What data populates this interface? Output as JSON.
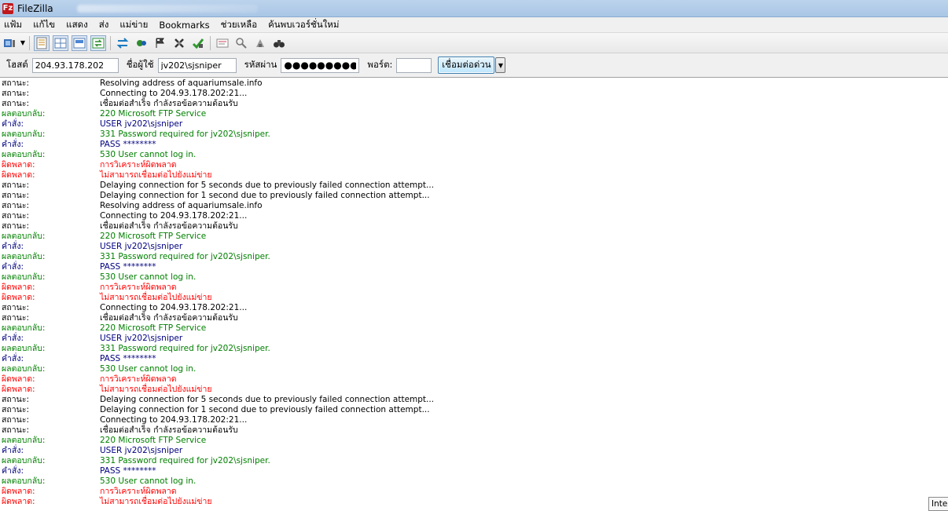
{
  "window": {
    "title": "FileZilla",
    "app_icon": "Fz"
  },
  "menu": [
    {
      "label": "แฟ้ม"
    },
    {
      "label": "แก้ไข"
    },
    {
      "label": "แสดง"
    },
    {
      "label": "ส่ง"
    },
    {
      "label": "แม่ข่าย"
    },
    {
      "label": "Bookmarks"
    },
    {
      "label": "ช่วยเหลือ"
    },
    {
      "label": "ค้นพบเวอร์ชั่นใหม่"
    }
  ],
  "toolbar": {
    "icons": [
      "site-manager-icon",
      "dropdown-arrow-icon",
      "message-log-toggle-icon",
      "local-tree-toggle-icon",
      "remote-tree-toggle-icon",
      "transfer-queue-toggle-icon",
      "refresh-icon",
      "process-queue-icon",
      "cancel-operation-icon",
      "disconnect-icon",
      "reconnect-icon",
      "filter-icon",
      "directory-comparison-icon",
      "synchronized-browsing-icon",
      "search-binoculars-icon"
    ]
  },
  "quickconnect": {
    "host_label": "โฮสต์",
    "host_value": "204.93.178.202",
    "user_label": "ชื่อผู้ใช้",
    "user_value": "jv202\\sjsniper",
    "pass_label": "รหัสผ่าน",
    "pass_value": "●●●●●●●●●",
    "port_label": "พอร์ต:",
    "port_value": "",
    "connect_label": "เชื่อมต่อด่วน",
    "dropdown_glyph": "▼"
  },
  "colors": {
    "status": "#000000",
    "response": "#008000",
    "command": "#000080",
    "error": "#ff0000"
  },
  "log": [
    {
      "type": "status",
      "label": "สถานะ:",
      "msg": "Resolving address of aquariumsale.info"
    },
    {
      "type": "status",
      "label": "สถานะ:",
      "msg": "Connecting to 204.93.178.202:21..."
    },
    {
      "type": "status",
      "label": "สถานะ:",
      "msg": "เชื่อมต่อสำเร็จ กำลังรอข้อความต้อนรับ"
    },
    {
      "type": "response",
      "label": "ผลตอบกลับ:",
      "msg": "220 Microsoft FTP Service"
    },
    {
      "type": "command",
      "label": "คำสั่ง:",
      "msg": "USER jv202\\sjsniper"
    },
    {
      "type": "response",
      "label": "ผลตอบกลับ:",
      "msg": "331 Password required for jv202\\sjsniper."
    },
    {
      "type": "command",
      "label": "คำสั่ง:",
      "msg": "PASS ********"
    },
    {
      "type": "response",
      "label": "ผลตอบกลับ:",
      "msg": "530 User cannot log in."
    },
    {
      "type": "error",
      "label": "ผิดพลาด:",
      "msg": "การวิเคราะห์ผิดพลาด"
    },
    {
      "type": "error",
      "label": "ผิดพลาด:",
      "msg": "ไม่สามารถเชื่อมต่อไปยังแม่ข่าย"
    },
    {
      "type": "status",
      "label": "สถานะ:",
      "msg": "Delaying connection for 5 seconds due to previously failed connection attempt..."
    },
    {
      "type": "status",
      "label": "สถานะ:",
      "msg": "Delaying connection for 1 second due to previously failed connection attempt..."
    },
    {
      "type": "status",
      "label": "สถานะ:",
      "msg": "Resolving address of aquariumsale.info"
    },
    {
      "type": "status",
      "label": "สถานะ:",
      "msg": "Connecting to 204.93.178.202:21..."
    },
    {
      "type": "status",
      "label": "สถานะ:",
      "msg": "เชื่อมต่อสำเร็จ กำลังรอข้อความต้อนรับ"
    },
    {
      "type": "response",
      "label": "ผลตอบกลับ:",
      "msg": "220 Microsoft FTP Service"
    },
    {
      "type": "command",
      "label": "คำสั่ง:",
      "msg": "USER jv202\\sjsniper"
    },
    {
      "type": "response",
      "label": "ผลตอบกลับ:",
      "msg": "331 Password required for jv202\\sjsniper."
    },
    {
      "type": "command",
      "label": "คำสั่ง:",
      "msg": "PASS ********"
    },
    {
      "type": "response",
      "label": "ผลตอบกลับ:",
      "msg": "530 User cannot log in."
    },
    {
      "type": "error",
      "label": "ผิดพลาด:",
      "msg": "การวิเคราะห์ผิดพลาด"
    },
    {
      "type": "error",
      "label": "ผิดพลาด:",
      "msg": "ไม่สามารถเชื่อมต่อไปยังแม่ข่าย"
    },
    {
      "type": "status",
      "label": "สถานะ:",
      "msg": "Connecting to 204.93.178.202:21..."
    },
    {
      "type": "status",
      "label": "สถานะ:",
      "msg": "เชื่อมต่อสำเร็จ กำลังรอข้อความต้อนรับ"
    },
    {
      "type": "response",
      "label": "ผลตอบกลับ:",
      "msg": "220 Microsoft FTP Service"
    },
    {
      "type": "command",
      "label": "คำสั่ง:",
      "msg": "USER jv202\\sjsniper"
    },
    {
      "type": "response",
      "label": "ผลตอบกลับ:",
      "msg": "331 Password required for jv202\\sjsniper."
    },
    {
      "type": "command",
      "label": "คำสั่ง:",
      "msg": "PASS ********"
    },
    {
      "type": "response",
      "label": "ผลตอบกลับ:",
      "msg": "530 User cannot log in."
    },
    {
      "type": "error",
      "label": "ผิดพลาด:",
      "msg": "การวิเคราะห์ผิดพลาด"
    },
    {
      "type": "error",
      "label": "ผิดพลาด:",
      "msg": "ไม่สามารถเชื่อมต่อไปยังแม่ข่าย"
    },
    {
      "type": "status",
      "label": "สถานะ:",
      "msg": "Delaying connection for 5 seconds due to previously failed connection attempt..."
    },
    {
      "type": "status",
      "label": "สถานะ:",
      "msg": "Delaying connection for 1 second due to previously failed connection attempt..."
    },
    {
      "type": "status",
      "label": "สถานะ:",
      "msg": "Connecting to 204.93.178.202:21..."
    },
    {
      "type": "status",
      "label": "สถานะ:",
      "msg": "เชื่อมต่อสำเร็จ กำลังรอข้อความต้อนรับ"
    },
    {
      "type": "response",
      "label": "ผลตอบกลับ:",
      "msg": "220 Microsoft FTP Service"
    },
    {
      "type": "command",
      "label": "คำสั่ง:",
      "msg": "USER jv202\\sjsniper"
    },
    {
      "type": "response",
      "label": "ผลตอบกลับ:",
      "msg": "331 Password required for jv202\\sjsniper."
    },
    {
      "type": "command",
      "label": "คำสั่ง:",
      "msg": "PASS ********"
    },
    {
      "type": "response",
      "label": "ผลตอบกลับ:",
      "msg": "530 User cannot log in."
    },
    {
      "type": "error",
      "label": "ผิดพลาด:",
      "msg": "การวิเคราะห์ผิดพลาด"
    },
    {
      "type": "error",
      "label": "ผิดพลาด:",
      "msg": "ไม่สามารถเชื่อมต่อไปยังแม่ข่าย"
    }
  ],
  "tooltip": {
    "text": "Inte"
  }
}
